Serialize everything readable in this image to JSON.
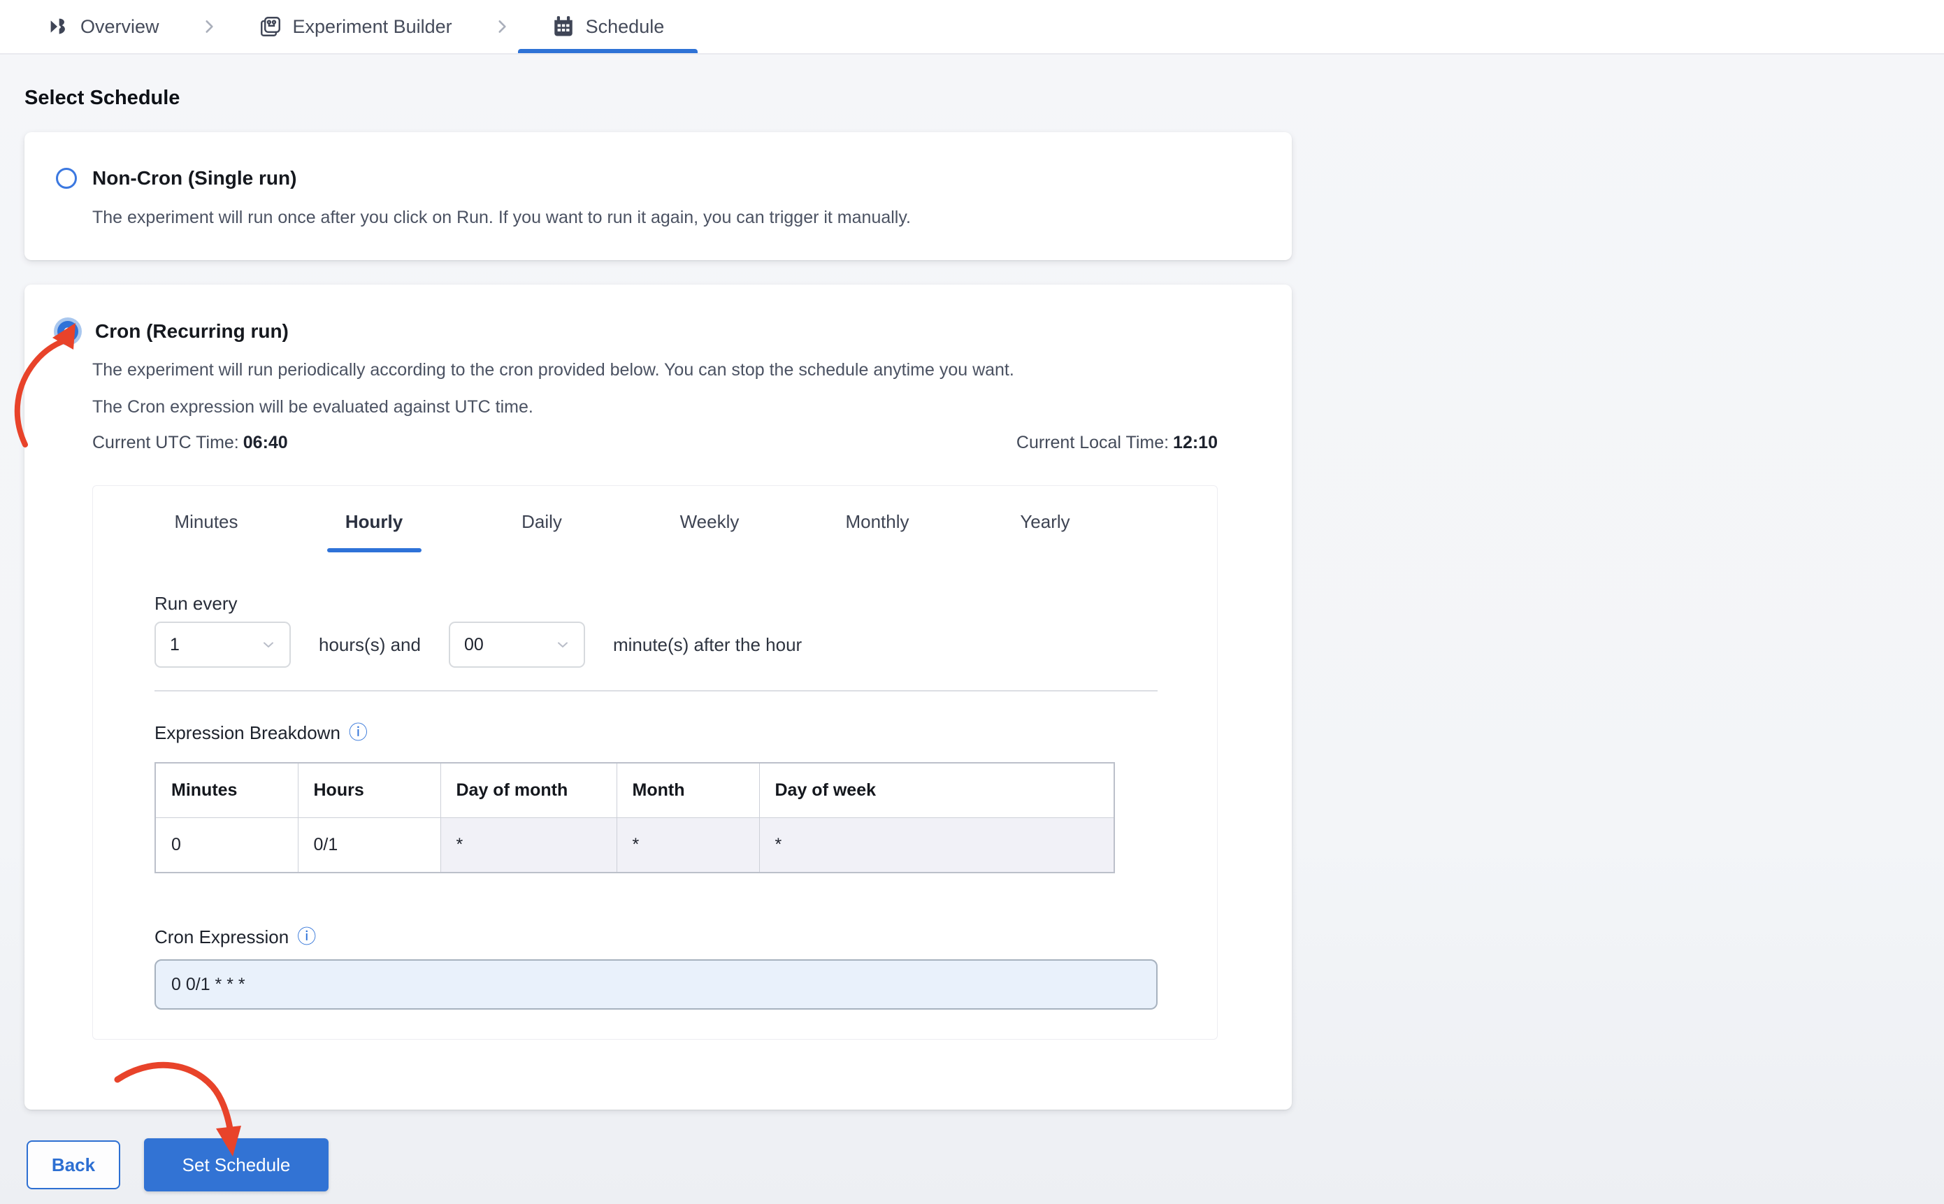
{
  "breadcrumb": {
    "items": [
      {
        "label": "Overview",
        "icon": "logo-icon",
        "active": false
      },
      {
        "label": "Experiment Builder",
        "icon": "workflow-icon",
        "active": false
      },
      {
        "label": "Schedule",
        "icon": "calendar-icon",
        "active": true
      }
    ]
  },
  "heading": "Select Schedule",
  "options": {
    "non_cron": {
      "title": "Non-Cron (Single run)",
      "selected": false,
      "description": "The experiment will run once after you click on Run. If you want to run it again, you can trigger it manually."
    },
    "cron": {
      "title": "Cron (Recurring run)",
      "selected": true,
      "description1": "The experiment will run periodically according to the cron provided below. You can stop the schedule anytime you want.",
      "description2": "The Cron expression will be evaluated against UTC time.",
      "utc_label": "Current UTC Time:",
      "utc_value": "06:40",
      "local_label": "Current Local Time:",
      "local_value": "12:10"
    }
  },
  "tabs": {
    "active": "Hourly",
    "items": [
      {
        "label": "Minutes"
      },
      {
        "label": "Hourly"
      },
      {
        "label": "Daily"
      },
      {
        "label": "Weekly"
      },
      {
        "label": "Monthly"
      },
      {
        "label": "Yearly"
      }
    ]
  },
  "hourly": {
    "run_every_label": "Run every",
    "hours_value": "1",
    "hours_text": "hours(s) and",
    "minutes_value": "00",
    "minutes_text": "minute(s) after the hour"
  },
  "breakdown": {
    "label": "Expression Breakdown",
    "headers": [
      "Minutes",
      "Hours",
      "Day of month",
      "Month",
      "Day of week"
    ],
    "row": [
      "0",
      "0/1",
      "*",
      "*",
      "*"
    ]
  },
  "cron_expression": {
    "label": "Cron Expression",
    "value": "0 0/1 * * *"
  },
  "actions": {
    "back": "Back",
    "submit": "Set Schedule"
  },
  "colors": {
    "accent_blue": "#2e72d6",
    "annotation_red": "#e8432a",
    "cron_input_bg": "#e9f1fb",
    "star_cell_bg": "#f1f1f7"
  }
}
